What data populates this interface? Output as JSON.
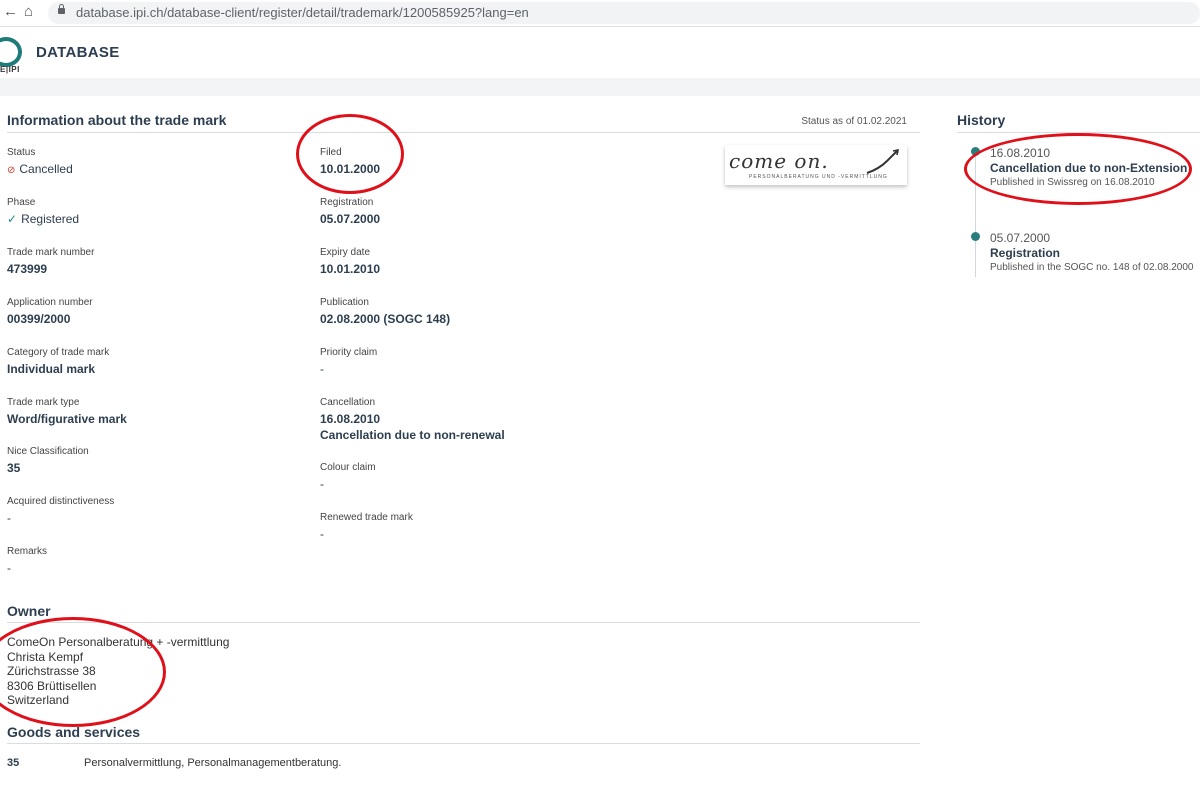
{
  "browser": {
    "url": "database.ipi.ch/database-client/register/detail/trademark/1200585925?lang=en",
    "back_icon": "arrow-left-icon",
    "reload_icon": "reload-icon",
    "home_icon": "home-icon"
  },
  "site": {
    "logo_text": "E|IPI",
    "title": "DATABASE"
  },
  "info": {
    "title": "Information about the trade mark",
    "status_as_of": "Status as of 01.02.2021",
    "left": [
      {
        "label": "Status",
        "value": "Cancelled"
      },
      {
        "label": "Phase",
        "value": "Registered"
      },
      {
        "label": "Trade mark number",
        "value": "473999"
      },
      {
        "label": "Application number",
        "value": "00399/2000"
      },
      {
        "label": "Category of trade mark",
        "value": "Individual mark"
      },
      {
        "label": "Trade mark type",
        "value": "Word/figurative mark"
      },
      {
        "label": "Nice Classification",
        "value": "35"
      },
      {
        "label": "Acquired distinctiveness",
        "value": "-"
      },
      {
        "label": "Remarks",
        "value": "-"
      }
    ],
    "right": [
      {
        "label": "Filed",
        "value": "10.01.2000"
      },
      {
        "label": "Registration",
        "value": "05.07.2000"
      },
      {
        "label": "Expiry date",
        "value": "10.01.2010"
      },
      {
        "label": "Publication",
        "value": "02.08.2000 (SOGC 148)"
      },
      {
        "label": "Priority claim",
        "value": "-"
      },
      {
        "label": "Cancellation",
        "value": "16.08.2010",
        "value2": "Cancellation due to non-renewal"
      },
      {
        "label": "Colour claim",
        "value": "-"
      },
      {
        "label": "Renewed trade mark",
        "value": "-"
      }
    ],
    "trademark_image": {
      "word": "come on.",
      "subtitle": "PERSONALBERATUNG UND -VERMITTLUNG"
    }
  },
  "owner": {
    "title": "Owner",
    "lines": [
      "ComeOn Personalberatung + -vermittlung",
      "Christa Kempf",
      "Zürichstrasse 38",
      "8306 Brüttisellen",
      "Switzerland"
    ]
  },
  "goods": {
    "title": "Goods and services",
    "class": "35",
    "text": "Personalvermittlung, Personalmanagementberatung."
  },
  "history": {
    "title": "History",
    "entries": [
      {
        "date": "16.08.2010",
        "title": "Cancellation due to non-Extension",
        "published": "Published in Swissreg on 16.08.2010"
      },
      {
        "date": "05.07.2000",
        "title": "Registration",
        "published": "Published in the SOGC no. 148 of 02.08.2000"
      }
    ]
  },
  "colors": {
    "accent": "#2a7d7d",
    "annotation": "#e0101a",
    "text": "#2c3e50",
    "cancelled_icon": "#c0392b"
  }
}
